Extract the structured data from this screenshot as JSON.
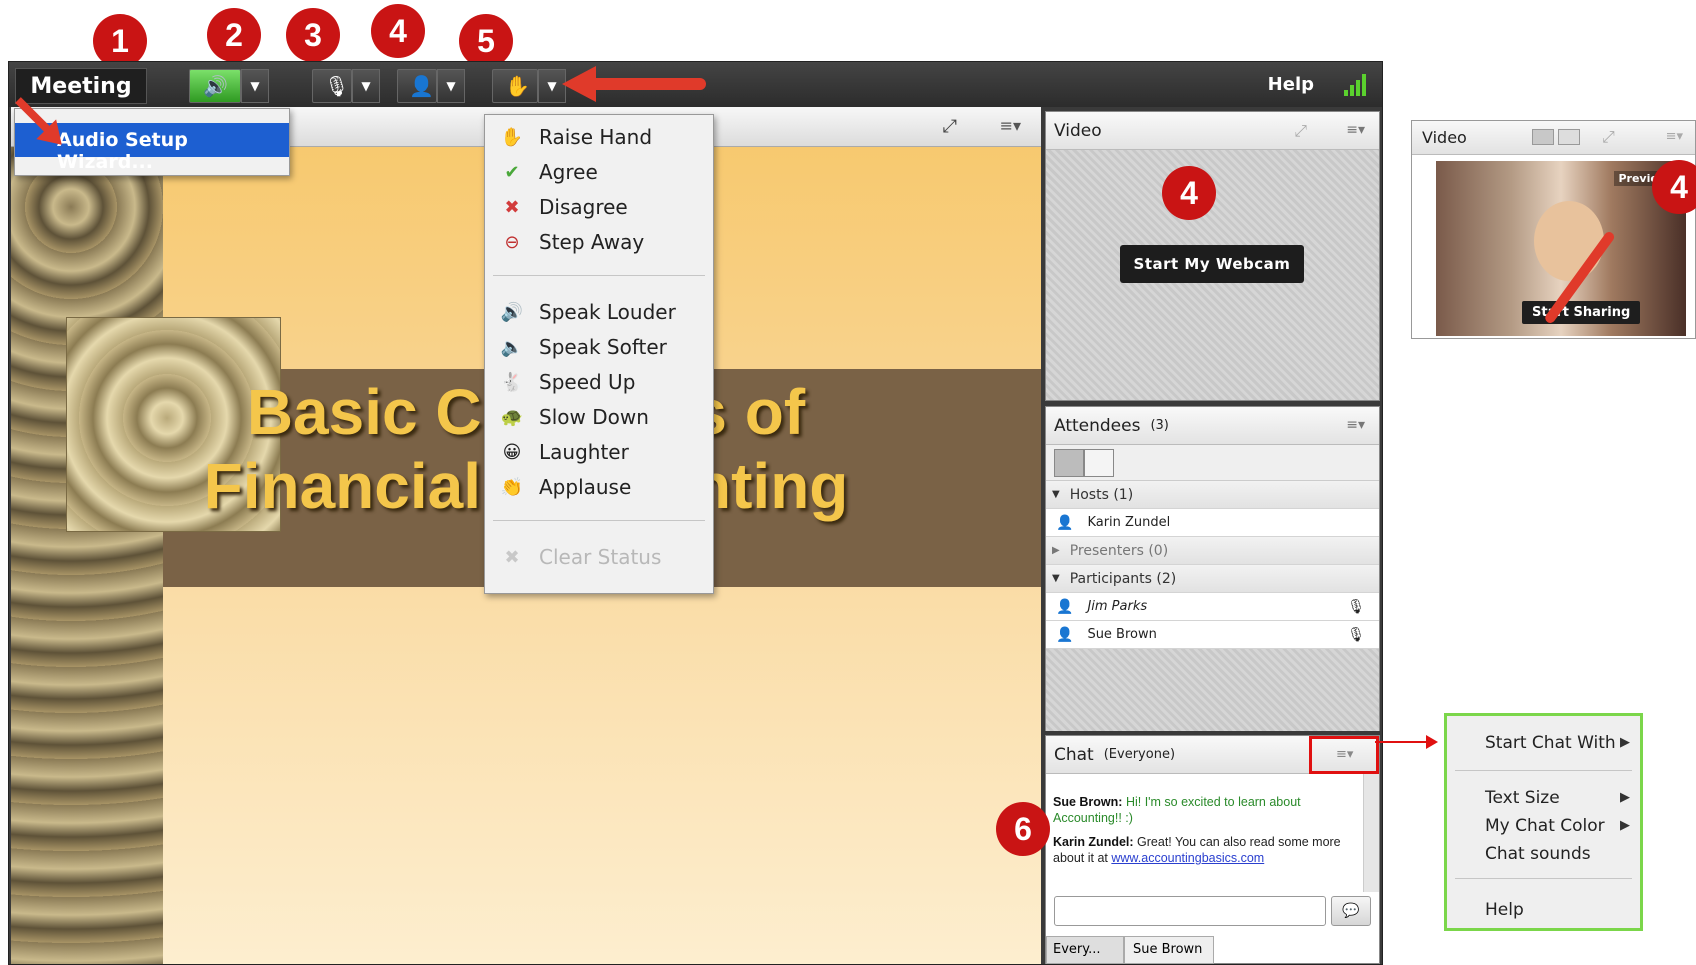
{
  "badges": [
    "1",
    "2",
    "3",
    "4",
    "5",
    "6"
  ],
  "side_badge": "4",
  "video_badge": "4",
  "toolbar": {
    "meeting_label": "Meeting",
    "help_label": "Help"
  },
  "audio_menu": {
    "item": "Audio Setup Wizard..."
  },
  "status_menu": {
    "items": [
      "Raise Hand",
      "Agree",
      "Disagree",
      "Step Away"
    ],
    "items2": [
      "Speak Louder",
      "Speak Softer",
      "Speed Up",
      "Slow Down",
      "Laughter",
      "Applause"
    ],
    "clear": "Clear Status"
  },
  "slide": {
    "line1": "Basic Concepts of",
    "line2": "Financial Accounting"
  },
  "video_pod": {
    "title": "Video",
    "webcam_button": "Start My Webcam"
  },
  "attendees": {
    "title": "Attendees",
    "count": "(3)",
    "hosts": "Hosts (1)",
    "host_name": "Karin Zundel",
    "presenters": "Presenters (0)",
    "participants": "Participants (2)",
    "participant_names": [
      "Jim Parks",
      "Sue Brown"
    ]
  },
  "chat": {
    "title": "Chat",
    "scope": "(Everyone)",
    "messages": [
      {
        "sender": "Sue Brown:",
        "text": "Hi!  I'm so excited to learn about Accounting!!  :)"
      },
      {
        "sender": "Karin Zundel:",
        "text": "Great!  You can also read some more about it at ",
        "link": "www.accountingbasics.com"
      }
    ],
    "tabs": [
      "Every...",
      "Sue Brown"
    ]
  },
  "video_preview": {
    "title": "Video",
    "preview_label": "Preview",
    "start_sharing": "Start Sharing"
  },
  "chat_options_menu": {
    "items": [
      "Start Chat With",
      "Text Size",
      "My Chat Color",
      "Chat sounds",
      "Help"
    ]
  },
  "colors": {
    "badge": "#c91414",
    "arrow": "#e03a2a",
    "wizard_highlight": "#1d5fd1",
    "context_border": "#7bd64a"
  }
}
